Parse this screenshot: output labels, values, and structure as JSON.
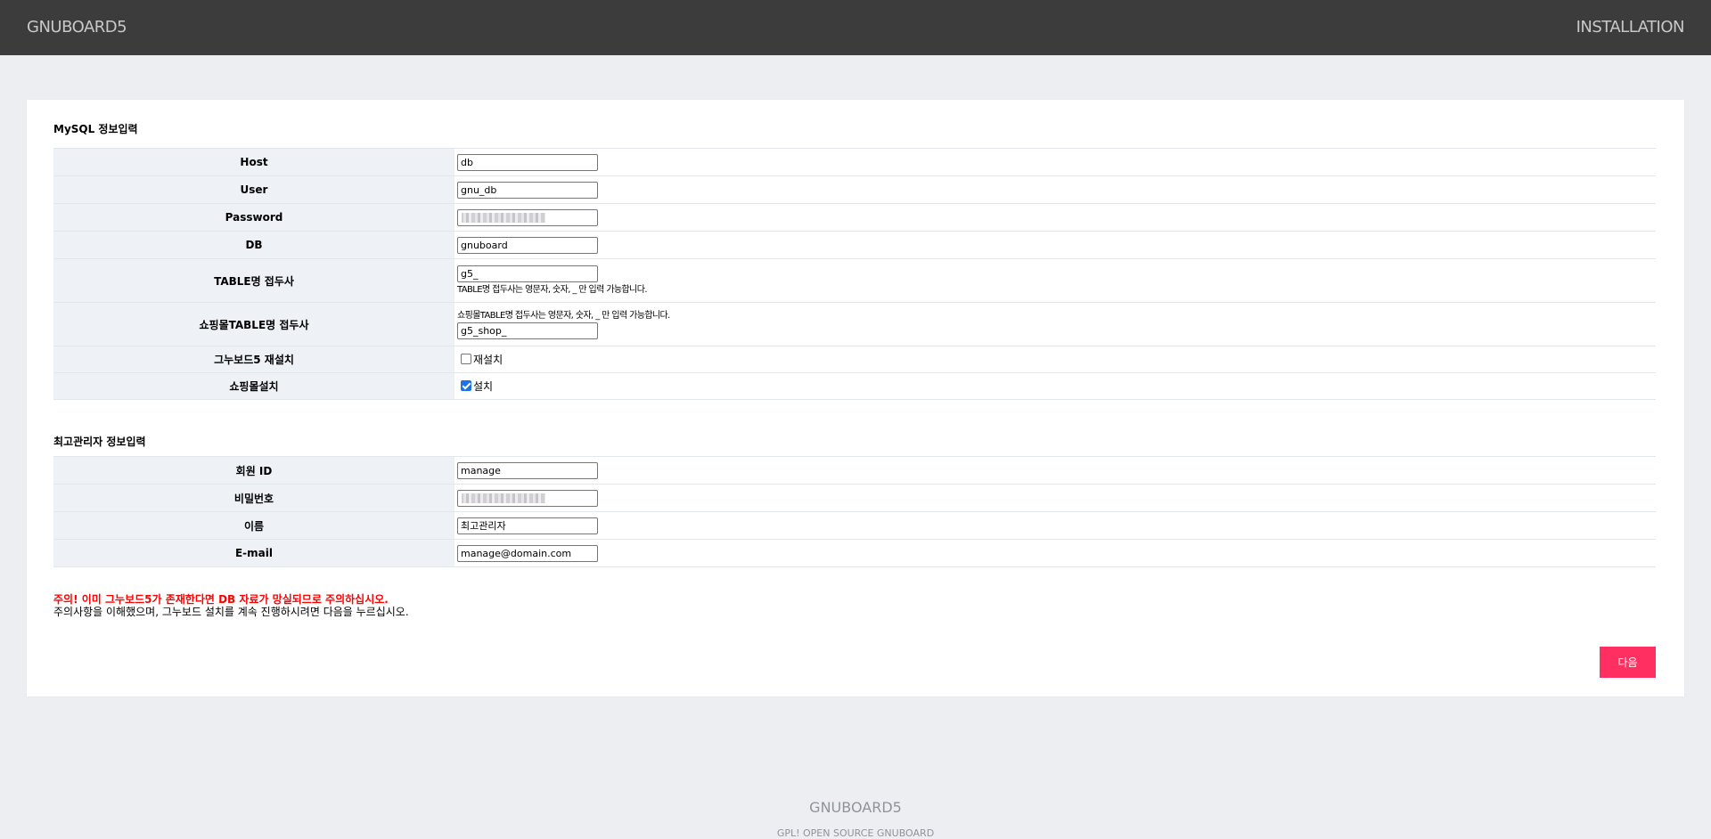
{
  "header": {
    "brand": "GNUBOARD5",
    "right_title": "INSTALLATION"
  },
  "mysql_section": {
    "title": "MySQL 정보입력",
    "host": {
      "label": "Host",
      "value": "db"
    },
    "user": {
      "label": "User",
      "value": "gnu_db"
    },
    "password": {
      "label": "Password",
      "value": "••••••••••••"
    },
    "db": {
      "label": "DB",
      "value": "gnuboard"
    },
    "table_prefix": {
      "label": "TABLE명 접두사",
      "value": "g5_",
      "help": "TABLE명 접두사는 영문자, 숫자, _ 만 입력 가능합니다."
    },
    "shop_prefix": {
      "label": "쇼핑몰TABLE명 접두사",
      "value": "g5_shop_",
      "help": "쇼핑몰TABLE명 접두사는 영문자, 숫자, _ 만 입력 가능합니다."
    },
    "reinstall": {
      "label": "그누보드5 재설치",
      "checkbox_label": "재설치",
      "checked": false
    },
    "shop_install": {
      "label": "쇼핑몰설치",
      "checkbox_label": "설치",
      "checked": true
    }
  },
  "admin_section": {
    "title": "최고관리자 정보입력",
    "member_id": {
      "label": "회원 ID",
      "value": "manage"
    },
    "password": {
      "label": "비밀번호",
      "value": "••••••••••••"
    },
    "name": {
      "label": "이름",
      "value": "최고관리자"
    },
    "email": {
      "label": "E-mail",
      "value": "manage@domain.com"
    }
  },
  "warning": {
    "line1": "주의! 이미 그누보드5가 존재한다면 DB 자료가 망실되므로 주의하십시오.",
    "line2": "주의사항을 이해했으며, 그누보드 설치를 계속 진행하시려면 다음을 누르십시오."
  },
  "next_button": "다음",
  "footer": {
    "brand": "GNUBOARD5",
    "sub": "GPL! OPEN SOURCE GNUBOARD"
  },
  "colors": {
    "header_bg": "#3c3c3c",
    "page_bg": "#eceef2",
    "button": "#ff3061",
    "warning": "#ff0000"
  }
}
